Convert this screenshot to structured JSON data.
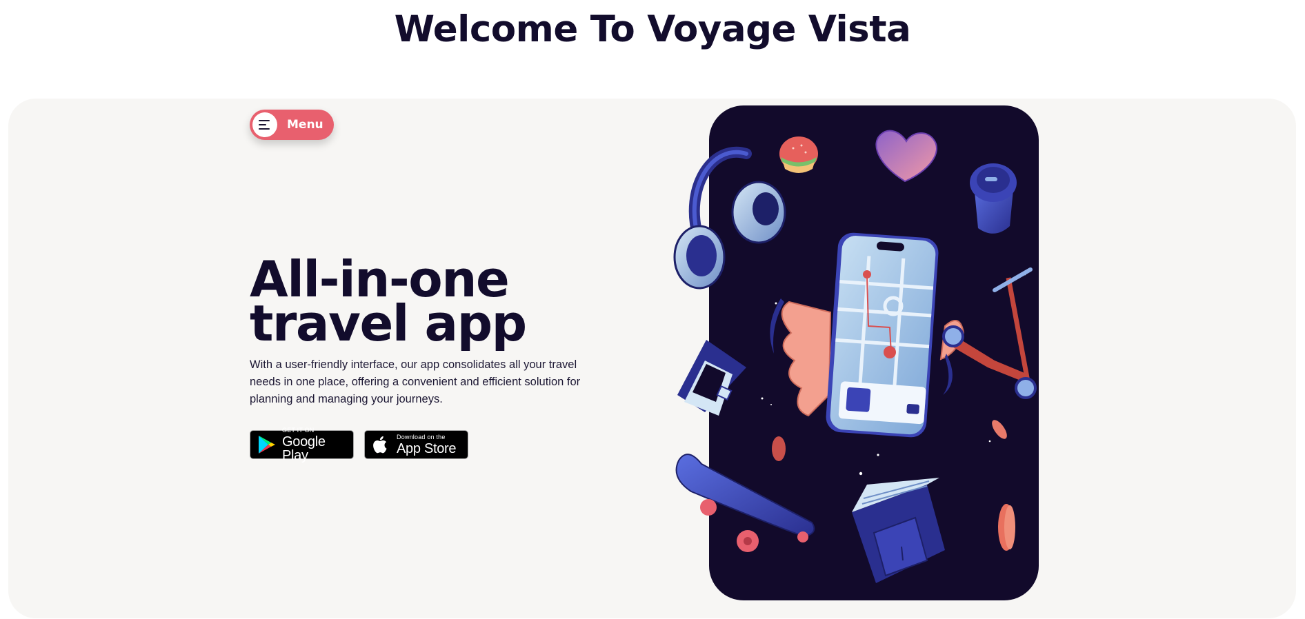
{
  "header": {
    "title": "Welcome To Voyage Vista"
  },
  "hero": {
    "menu_label": "Menu",
    "heading_line1": "All-in-one",
    "heading_line2": "travel app",
    "description": "With a user-friendly interface, our app consolidates all your travel needs in one place, offering a convenient and efficient solution for planning and managing your journeys.",
    "google_play": {
      "small": "GET IT ON",
      "big": "Google Play"
    },
    "app_store": {
      "small": "Download on the",
      "big": "App Store"
    }
  },
  "colors": {
    "brand_dark": "#120c2c",
    "accent": "#e8606e",
    "hero_bg": "#f7f6f4",
    "card_bg": "#120a2b"
  },
  "icons": [
    "menu-icon",
    "google-play-icon",
    "apple-icon",
    "headphones-icon",
    "burger-icon",
    "heart-icon",
    "coffee-cup-icon",
    "scooter-icon",
    "laptop-icon",
    "skateboard-icon",
    "book-icon",
    "phone-map-icon"
  ]
}
